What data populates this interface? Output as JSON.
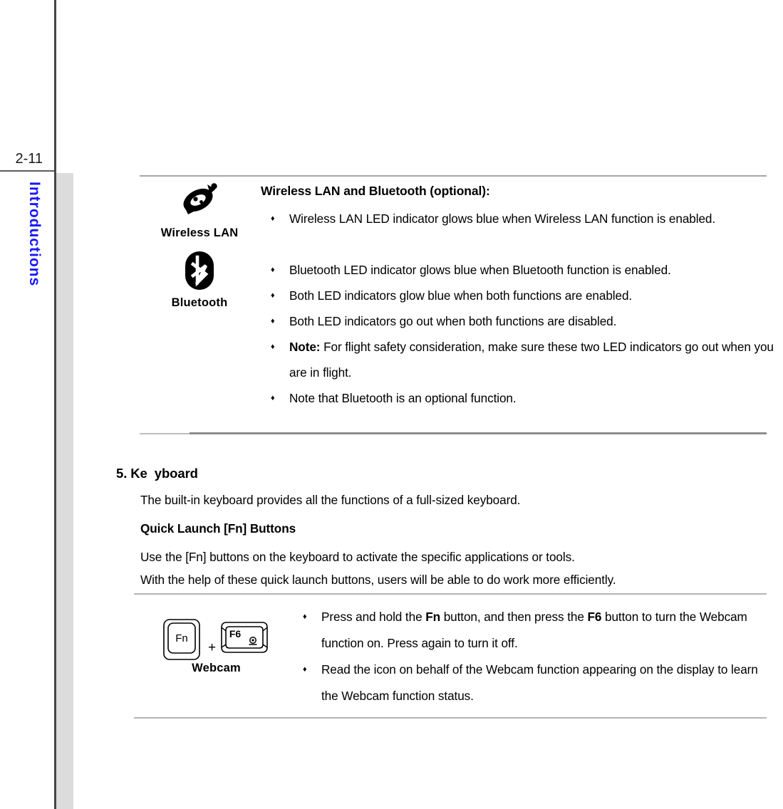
{
  "page": {
    "number": "2-11",
    "chapter_tab": "Introductions",
    "chapter_tab_color": "#1717ff"
  },
  "wireless_table": {
    "icons": [
      {
        "name": "wireless-lan-icon",
        "caption": "Wireless LAN"
      },
      {
        "name": "bluetooth-icon",
        "caption": "Bluetooth"
      }
    ],
    "heading": "Wireless LAN and Bluetooth (optional):",
    "bullets": [
      {
        "text": "Wireless LAN LED indicator glows blue when Wireless LAN function is enabled."
      },
      {
        "text": "Bluetooth LED indicator glows blue when Bluetooth function is enabled."
      },
      {
        "text": "Both LED indicators glow blue when both functions are enabled."
      },
      {
        "text": "Both LED indicators go out when both functions are disabled."
      },
      {
        "bold_lead": "Note:",
        "text": " For flight safety consideration, make sure these two LED indicators go out when you are in flight."
      },
      {
        "text": "Note that Bluetooth is an optional function."
      }
    ]
  },
  "keyboard_section": {
    "heading": "5. Ke  yboard",
    "paragraphs": [
      "The built-in keyboard provides all the functions of a full-sized keyboard.",
      "Quick Launch [Fn] Buttons",
      "Use the [Fn] buttons on the keyboard to activate the specific applications or tools.",
      "With the help of these quick launch buttons, users will be able to do work more efficiently."
    ]
  },
  "webcam_table": {
    "keys": {
      "fn_label": "Fn",
      "plus": "+",
      "f6_label": "F6"
    },
    "caption": "Webcam",
    "bullets": [
      {
        "parts": [
          {
            "t": "Press and hold the ",
            "b": false
          },
          {
            "t": "Fn",
            "b": true
          },
          {
            "t": " button, and then press the ",
            "b": false
          },
          {
            "t": "F6",
            "b": true
          },
          {
            "t": " button to turn the Webcam function on.    Press again to turn it off.",
            "b": false
          }
        ]
      },
      {
        "parts": [
          {
            "t": "Read the icon on behalf of the Webcam function appearing on the display to learn the Webcam function status.",
            "b": false
          }
        ]
      }
    ]
  },
  "glyphs": {
    "bullet": "♦"
  }
}
